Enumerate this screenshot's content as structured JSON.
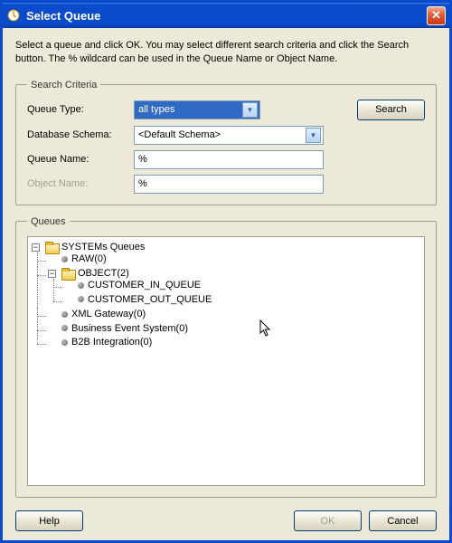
{
  "window": {
    "title": "Select Queue"
  },
  "instructions": "Select a queue and click OK. You may select different search criteria and click the Search button. The % wildcard can be used in the Queue Name or Object Name.",
  "criteria": {
    "legend": "Search Criteria",
    "queue_type_label": "Queue Type:",
    "queue_type_value": "all types",
    "db_schema_label": "Database Schema:",
    "db_schema_value": "<Default Schema>",
    "queue_name_label": "Queue Name:",
    "queue_name_value": "%",
    "object_name_label": "Object Name:",
    "object_name_value": "%",
    "search_label": "Search"
  },
  "queues": {
    "legend": "Queues",
    "root": "SYSTEMs Queues",
    "items": [
      {
        "label": "RAW(0)"
      },
      {
        "label": "OBJECT(2)",
        "children": [
          {
            "label": "CUSTOMER_IN_QUEUE"
          },
          {
            "label": "CUSTOMER_OUT_QUEUE"
          }
        ]
      },
      {
        "label": "XML Gateway(0)"
      },
      {
        "label": "Business Event System(0)"
      },
      {
        "label": "B2B Integration(0)"
      }
    ]
  },
  "footer": {
    "help": "Help",
    "ok": "OK",
    "cancel": "Cancel"
  },
  "glyphs": {
    "minus": "−",
    "close": "✕",
    "down": "▼"
  }
}
